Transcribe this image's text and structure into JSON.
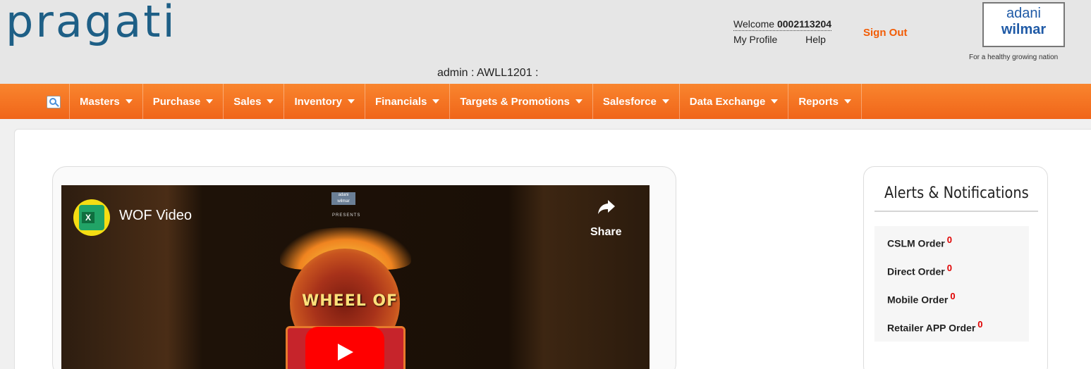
{
  "header": {
    "logo": "pragati",
    "welcome_prefix": "Welcome",
    "user_id": "0002113204",
    "my_profile": "My Profile",
    "help": "Help",
    "sign_out": "Sign Out",
    "brand_line1": "adani",
    "brand_line2": "wilmar",
    "tagline": "For a healthy growing nation",
    "admin_line": "admin : AWLL1201 :"
  },
  "nav": {
    "search_icon": "search-icon",
    "items": [
      {
        "label": "Masters"
      },
      {
        "label": "Purchase"
      },
      {
        "label": "Sales"
      },
      {
        "label": "Inventory"
      },
      {
        "label": "Financials"
      },
      {
        "label": "Targets & Promotions"
      },
      {
        "label": "Salesforce"
      },
      {
        "label": "Data Exchange"
      },
      {
        "label": "Reports"
      }
    ]
  },
  "video": {
    "title": "WOF Video",
    "share_label": "Share",
    "channel_logo_letter": "X",
    "embedded_brand_line1": "adani",
    "embedded_brand_line2": "wilmar",
    "presents": "PRESENTS",
    "thumbnail_text": "WHEEL OF"
  },
  "alerts": {
    "title": "Alerts & Notifications",
    "items": [
      {
        "label": "CSLM Order",
        "count": "0"
      },
      {
        "label": "Direct Order",
        "count": "0"
      },
      {
        "label": "Mobile Order",
        "count": "0"
      },
      {
        "label": "Retailer APP Order",
        "count": "0"
      }
    ]
  },
  "colors": {
    "nav_orange": "#f06519",
    "logo_blue": "#1e5f86",
    "sign_out": "#f25c05",
    "alert_count": "#e00000"
  }
}
